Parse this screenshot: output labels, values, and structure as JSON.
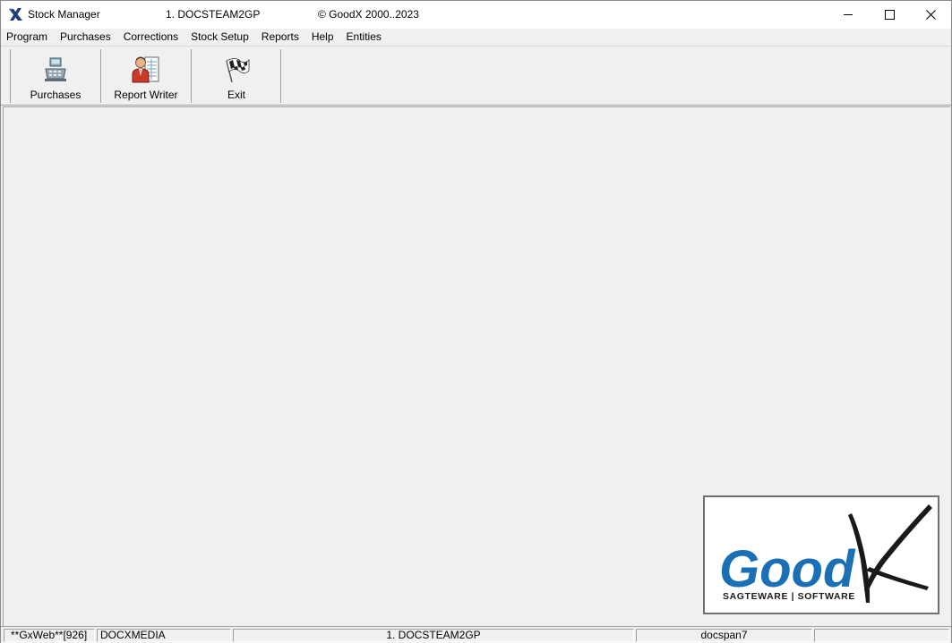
{
  "window": {
    "app_title": "Stock Manager",
    "database": "1. DOCSTEAM2GP",
    "copyright": "© GoodX 2000..2023",
    "controls": {
      "minimize_icon": "minimize-icon",
      "maximize_icon": "maximize-icon",
      "close_icon": "close-icon"
    }
  },
  "menu": {
    "items": [
      {
        "label": "Program"
      },
      {
        "label": "Purchases"
      },
      {
        "label": "Corrections"
      },
      {
        "label": "Stock Setup"
      },
      {
        "label": "Reports"
      },
      {
        "label": "Help"
      },
      {
        "label": "Entities"
      }
    ]
  },
  "toolbar": {
    "buttons": [
      {
        "label": "Purchases",
        "icon": "cash-register-icon"
      },
      {
        "label": "Report Writer",
        "icon": "report-writer-icon"
      },
      {
        "label": "Exit",
        "icon": "checkered-flag-icon"
      }
    ]
  },
  "logo": {
    "brand": "Good",
    "tagline": "SAGTEWARE | SOFTWARE",
    "brand_color": "#1a6fb5",
    "x_color": "#1a1a1a"
  },
  "statusbar": {
    "panels": [
      {
        "text": "**GxWeb**[926]"
      },
      {
        "text": "DOCXMEDIA"
      },
      {
        "text": ""
      },
      {
        "text": "1. DOCSTEAM2GP"
      },
      {
        "text": "docspan7"
      },
      {
        "text": ""
      }
    ]
  }
}
